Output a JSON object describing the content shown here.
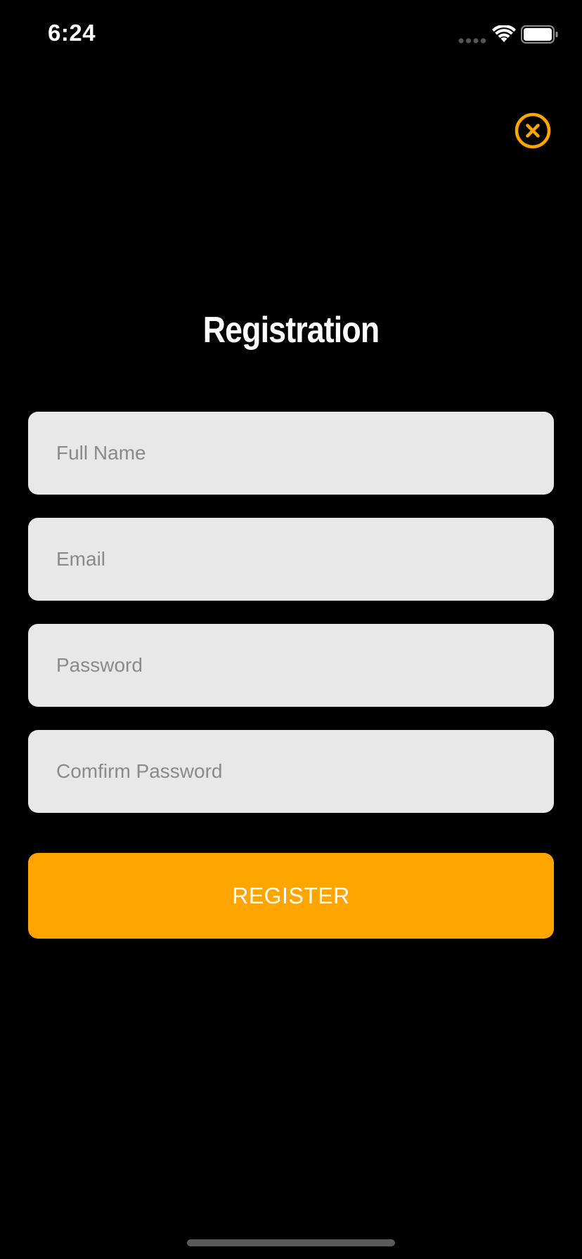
{
  "status_bar": {
    "time": "6:24"
  },
  "header": {
    "close_icon": "close-circle-icon",
    "title": "Registration"
  },
  "form": {
    "full_name": {
      "value": "",
      "placeholder": "Full Name"
    },
    "email": {
      "value": "",
      "placeholder": "Email"
    },
    "password": {
      "value": "",
      "placeholder": "Password"
    },
    "confirm_password": {
      "value": "",
      "placeholder": "Comfirm Password"
    },
    "register_label": "REGISTER"
  },
  "colors": {
    "background": "#000000",
    "accent": "#ffa500",
    "field_background": "#e8e8e8",
    "placeholder": "#8a8a8a",
    "text": "#ffffff"
  }
}
